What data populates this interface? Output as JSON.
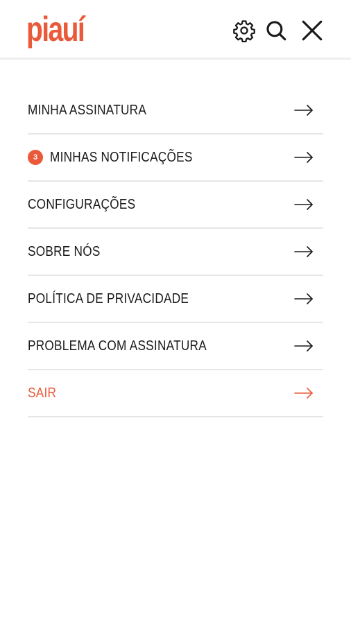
{
  "header": {
    "logo_text": "piauí",
    "icons": [
      "settings-gear-icon",
      "search-icon",
      "close-icon"
    ]
  },
  "menu": {
    "items": [
      {
        "label": "MINHA ASSINATURA"
      },
      {
        "label": "MINHAS NOTIFICAÇÕES",
        "badge": "3"
      },
      {
        "label": "CONFIGURAÇÕES"
      },
      {
        "label": "SOBRE NÓS"
      },
      {
        "label": "POLÍTICA DE PRIVACIDADE"
      },
      {
        "label": "PROBLEMA COM ASSINATURA"
      },
      {
        "label": "SAIR"
      }
    ]
  },
  "colors": {
    "brand": "#ea5a3a",
    "text": "#1a1a1a",
    "divider": "#e6e6e6"
  }
}
